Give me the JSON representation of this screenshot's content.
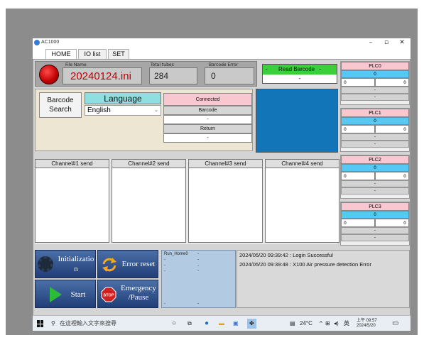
{
  "window": {
    "title": "AC1000",
    "minimize": "–",
    "maximize": "▫",
    "close": "✕"
  },
  "tabs": [
    {
      "label": "HOME"
    },
    {
      "label": "IO list"
    },
    {
      "label": "SET"
    }
  ],
  "info": {
    "file_name_label": "File Name",
    "file_name": "20240124.ini",
    "total_tubes_label": "Total tubes",
    "total_tubes": "284",
    "barcode_error_label": "Barcode Error",
    "barcode_error": "0"
  },
  "read_barcode": {
    "label": "Read Barcode",
    "left_mark": "-",
    "right_mark": "-",
    "value": "-"
  },
  "barcode_search": {
    "line1": "Barcode",
    "line2": "Search"
  },
  "language": {
    "label": "Language",
    "selected": "English",
    "chevron": "⌄"
  },
  "status": {
    "connected": "Connected",
    "barcode_label": "Barcode",
    "barcode_value": "-",
    "return_label": "Return",
    "return_value": "-"
  },
  "channels": [
    {
      "label": "Channel#1 send"
    },
    {
      "label": "Channel#2 send"
    },
    {
      "label": "Channel#3 send"
    },
    {
      "label": "Channel#4 send"
    }
  ],
  "plcs": [
    {
      "name": "PLC0",
      "value": "0",
      "left": "0",
      "right": "0",
      "bar1": "-",
      "bar2": "-"
    },
    {
      "name": "PLC1",
      "value": "0",
      "left": "0",
      "right": "0",
      "bar1": "-",
      "bar2": "-"
    },
    {
      "name": "PLC2",
      "value": "0",
      "left": "0",
      "right": "0",
      "bar1": "-",
      "bar2": "-"
    },
    {
      "name": "PLC3",
      "value": "0",
      "left": "0",
      "right": "0",
      "bar1": "-",
      "bar2": "-"
    }
  ],
  "buttons": {
    "init_line1": "Initializatio",
    "init_line2": "n",
    "error_reset": "Error reset",
    "start": "Start",
    "emergency_line1": "Emergency",
    "emergency_line2": "/Pause",
    "stop_sign": "STOP"
  },
  "run_panel": {
    "label": "Run_Home0",
    "dash": "-"
  },
  "log": [
    "2024/05/20 09:39:42 : Login Successful",
    "2024/05/20 09:39:48 : X100 Air pressure detection Error"
  ],
  "taskbar": {
    "search_placeholder": "在這裡輸入文字來搜尋",
    "weather": "24°C",
    "ime": "英",
    "time": "上午 09:57",
    "date": "2024/5/20",
    "colors": {
      "accent": "#1275b8",
      "green": "#3ccf3c",
      "pink": "#f8c7cf",
      "cyan": "#55c8f3"
    }
  }
}
